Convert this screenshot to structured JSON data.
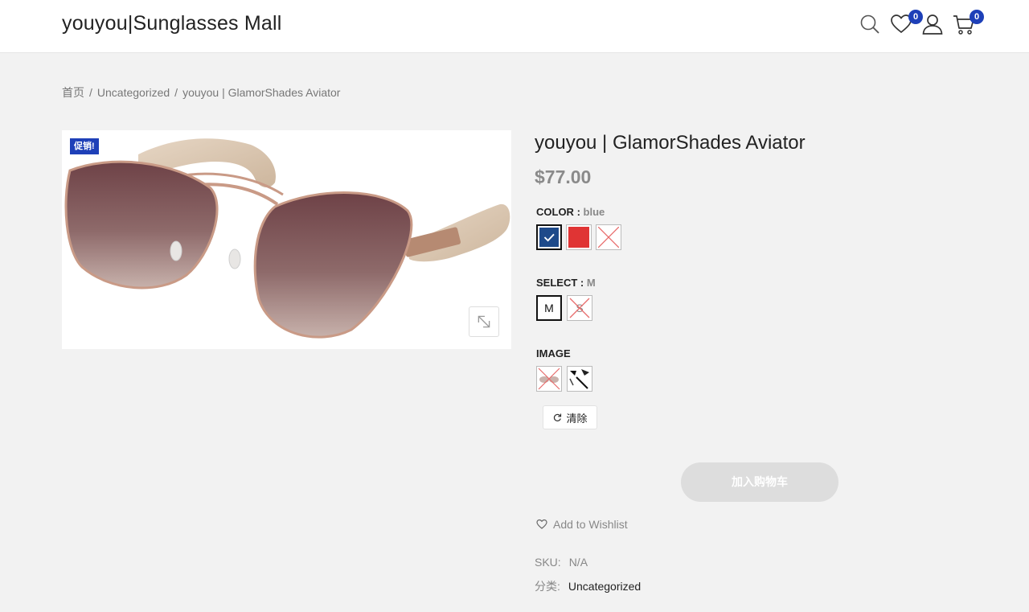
{
  "header": {
    "site_title": "youyou|Sunglasses Mall",
    "wishlist_count": "0",
    "cart_count": "0",
    "icons": [
      "search-icon",
      "heart-icon",
      "user-icon",
      "cart-icon"
    ]
  },
  "breadcrumb": {
    "items": [
      "首页",
      "Uncategorized",
      "youyou | GlamorShades Aviator"
    ],
    "separator": "/"
  },
  "gallery": {
    "sale_badge": "促销!",
    "zoom_icon": "expand-icon"
  },
  "product": {
    "title": "youyou | GlamorShades Aviator",
    "price": "$77.00",
    "color_attr": {
      "label": "COLOR",
      "selected": "blue",
      "options": [
        {
          "name": "blue",
          "color": "#1e4a8a",
          "selected": true,
          "available": true
        },
        {
          "name": "red",
          "color": "#e03434",
          "selected": false,
          "available": true
        },
        {
          "name": "unavailable",
          "color": "#ffffff",
          "selected": false,
          "available": false
        }
      ]
    },
    "select_attr": {
      "label": "SELECT",
      "selected": "M",
      "options": [
        {
          "name": "M",
          "selected": true,
          "available": true
        },
        {
          "name": "S",
          "selected": false,
          "available": false
        }
      ]
    },
    "image_attr": {
      "label": "IMAGE",
      "options": [
        {
          "name": "image-1",
          "available": false
        },
        {
          "name": "image-2",
          "available": true
        }
      ]
    },
    "clear_label": "清除",
    "add_to_cart_label": "加入购物车",
    "wishlist_label": "Add to Wishlist",
    "sku_label": "SKU:",
    "sku_value": "N/A",
    "category_label": "分类:",
    "category_value": "Uncategorized"
  },
  "colors": {
    "accent": "#1e40b8",
    "cart_button_disabled": "#dddddd"
  }
}
